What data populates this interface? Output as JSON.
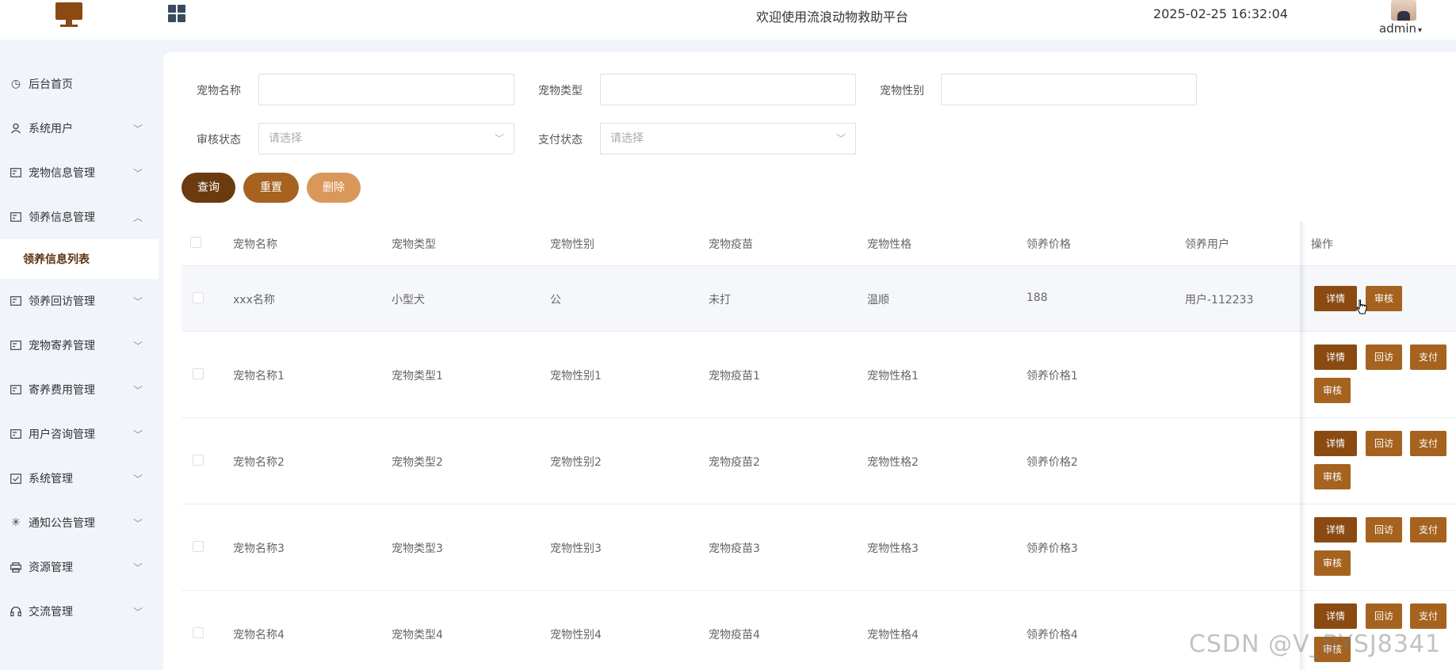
{
  "header": {
    "title": "欢迎使用流浪动物救助平台",
    "datetime": "2025-02-25 16:32:04",
    "user": "admin"
  },
  "sidebar": {
    "items": [
      {
        "label": "后台首页",
        "icon": "clock-icon",
        "expandable": false
      },
      {
        "label": "系统用户",
        "icon": "user-icon",
        "expandable": true
      },
      {
        "label": "宠物信息管理",
        "icon": "card-icon",
        "expandable": true
      },
      {
        "label": "领养信息管理",
        "icon": "card-icon",
        "expandable": true,
        "expanded": true
      },
      {
        "label": "领养回访管理",
        "icon": "card-icon",
        "expandable": true
      },
      {
        "label": "宠物寄养管理",
        "icon": "card-icon",
        "expandable": true
      },
      {
        "label": "寄养费用管理",
        "icon": "card-icon",
        "expandable": true
      },
      {
        "label": "用户咨询管理",
        "icon": "card-icon",
        "expandable": true
      },
      {
        "label": "系统管理",
        "icon": "check-box-icon",
        "expandable": true
      },
      {
        "label": "通知公告管理",
        "icon": "loading-icon",
        "expandable": true
      },
      {
        "label": "资源管理",
        "icon": "printer-icon",
        "expandable": true
      },
      {
        "label": "交流管理",
        "icon": "headset-icon",
        "expandable": true
      }
    ],
    "active_sub": "领养信息列表"
  },
  "filters": {
    "pet_name_label": "宠物名称",
    "pet_type_label": "宠物类型",
    "pet_gender_label": "宠物性别",
    "audit_status_label": "审核状态",
    "pay_status_label": "支付状态",
    "select_placeholder": "请选择"
  },
  "actions": {
    "query": "查询",
    "reset": "重置",
    "delete": "删除"
  },
  "table": {
    "headers": [
      "宠物名称",
      "宠物类型",
      "宠物性别",
      "宠物疫苗",
      "宠物性格",
      "领养价格",
      "领养用户",
      "操作"
    ],
    "rows": [
      {
        "cells": [
          "xxx名称",
          "小型犬",
          "公",
          "未打",
          "温顺",
          "188",
          "用户-112233"
        ],
        "buttons": [
          "详情",
          "审核"
        ]
      },
      {
        "cells": [
          "宠物名称1",
          "宠物类型1",
          "宠物性别1",
          "宠物疫苗1",
          "宠物性格1",
          "领养价格1",
          ""
        ],
        "buttons": [
          "详情",
          "回访",
          "支付",
          "审核"
        ]
      },
      {
        "cells": [
          "宠物名称2",
          "宠物类型2",
          "宠物性别2",
          "宠物疫苗2",
          "宠物性格2",
          "领养价格2",
          ""
        ],
        "buttons": [
          "详情",
          "回访",
          "支付",
          "审核"
        ]
      },
      {
        "cells": [
          "宠物名称3",
          "宠物类型3",
          "宠物性别3",
          "宠物疫苗3",
          "宠物性格3",
          "领养价格3",
          ""
        ],
        "buttons": [
          "详情",
          "回访",
          "支付",
          "审核"
        ]
      },
      {
        "cells": [
          "宠物名称4",
          "宠物类型4",
          "宠物性别4",
          "宠物疫苗4",
          "宠物性格4",
          "领养价格4",
          ""
        ],
        "buttons": [
          "详情",
          "回访",
          "支付",
          "审核"
        ]
      }
    ]
  },
  "watermark": "CSDN @V_BYSJ8341",
  "colors": {
    "brand_dark": "#6b3a0e",
    "brand_mid": "#a5631f",
    "brand_light": "#d9985a",
    "action_dark": "#8a4a12"
  }
}
